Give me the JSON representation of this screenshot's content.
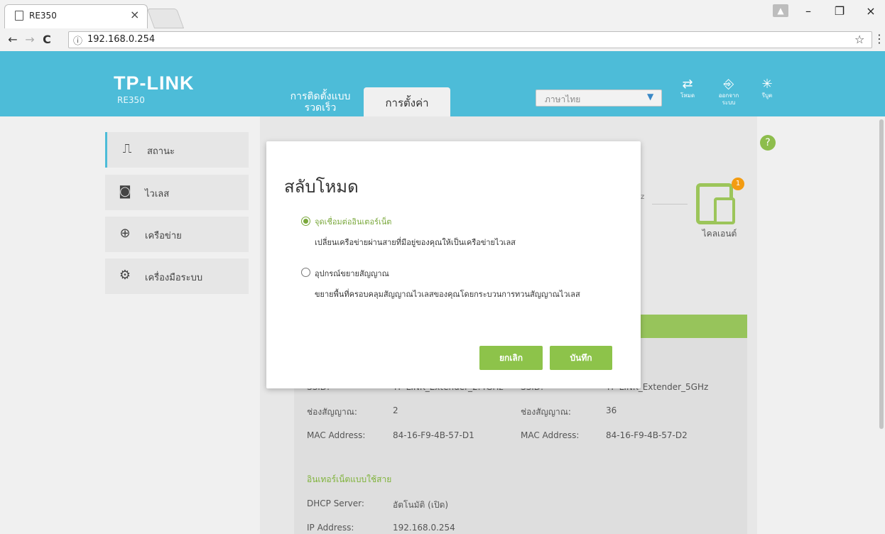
{
  "browser": {
    "tab_title": "RE350",
    "tab_close": "×",
    "url_info_icon": "ⓘ",
    "url": "192.168.0.254",
    "back": "←",
    "forward": "→",
    "reload": "C",
    "star": "☆",
    "menu": "⋮",
    "window_min": "–",
    "window_restore": "❐",
    "window_close": "×"
  },
  "header": {
    "brand": "TP-LINK",
    "model": "RE350",
    "tab_quick_setup": "การติดตั้งแบบรวดเร็ว",
    "tab_settings": "การตั้งค่า",
    "language": "ภาษาไทย",
    "icons": [
      {
        "label": "โหมด",
        "name": "mode-icon"
      },
      {
        "label": "ออกจากระบบ",
        "name": "logout-icon"
      },
      {
        "label": "รีบูต",
        "name": "reboot-icon"
      }
    ]
  },
  "sidebar": {
    "items": [
      {
        "label": "สถานะ",
        "icon": "status-icon"
      },
      {
        "label": "ไวเลส",
        "icon": "wireless-icon"
      },
      {
        "label": "เครือข่าย",
        "icon": "network-icon"
      },
      {
        "label": "เครื่องมือระบบ",
        "icon": "system-tools-icon"
      }
    ]
  },
  "status": {
    "clients_label": "ไคลเอนต์",
    "clients_count": "1",
    "ghz_fragment": "z",
    "help": "?",
    "wireless_2g": {
      "ssid_label": "SSID:",
      "ssid_value": "TP-LINK_Extender_2.4GHz",
      "channel_label": "ช่องสัญญาณ:",
      "channel_value": "2",
      "mac_label": "MAC Address:",
      "mac_value": "84-16-F9-4B-57-D1"
    },
    "wireless_5g": {
      "ssid_label": "SSID:",
      "ssid_value": "TP-LINK_Extender_5GHz",
      "channel_label": "ช่องสัญญาณ:",
      "channel_value": "36",
      "mac_label": "MAC Address:",
      "mac_value": "84-16-F9-4B-57-D2"
    },
    "wired_section": "อินเทอร์เน็ตแบบใช้สาย",
    "dhcp_label": "DHCP Server:",
    "dhcp_value": "อัตโนมัติ (เปิด)",
    "ip_label": "IP Address:",
    "ip_value": "192.168.0.254"
  },
  "modal": {
    "title": "สลับโหมด",
    "option1_label": "จุดเชื่อมต่ออินเตอร์เน็ต",
    "option1_desc": "เปลี่ยนเครือข่ายผ่านสายที่มีอยู่ของคุณให้เป็นเครือข่ายไวเลส",
    "option2_label": "อุปกรณ์ขยายสัญญาณ",
    "option2_desc": "ขยายพื้นที่ครอบคลุมสัญญาณไวเลสของคุณโดยกระบวนการทวนสัญญาณไวเลส",
    "cancel": "ยกเลิก",
    "save": "บันทึก"
  },
  "colors": {
    "brand_blue": "#4dbcd8",
    "accent_green": "#8dc34a",
    "badge_orange": "#f39c12"
  }
}
